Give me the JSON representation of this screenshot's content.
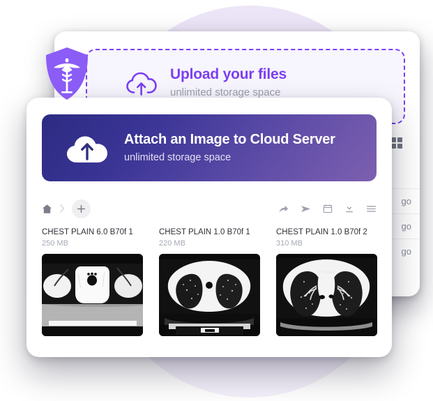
{
  "background_card": {
    "dropzone": {
      "title": "Upload your files",
      "subtitle": "unlimited storage space",
      "icon": "cloud-upload-outline-icon",
      "border_color": "#7b3ff2"
    },
    "grid_icon": "grid-view-icon",
    "rows": [
      {
        "time_text": "go"
      },
      {
        "time_text": "go"
      },
      {
        "time_text": "go"
      }
    ]
  },
  "badge": {
    "icon": "medical-shield-caduceus-icon",
    "color": "#8b5cf6"
  },
  "modal": {
    "banner": {
      "title": "Attach an Image to Cloud Server",
      "subtitle": "unlimited storage space",
      "icon": "cloud-upload-solid-icon",
      "gradient_from": "#2c2b82",
      "gradient_to": "#7d60b0"
    },
    "toolbar": {
      "home_icon": "home-icon",
      "separator_icon": "chevron-right-icon",
      "add_icon": "plus-icon",
      "actions": [
        {
          "name": "share-icon"
        },
        {
          "name": "send-icon"
        },
        {
          "name": "calendar-icon"
        },
        {
          "name": "download-icon"
        },
        {
          "name": "menu-icon"
        }
      ]
    },
    "files": [
      {
        "name": "CHEST PLAIN 6.0 B70f 1",
        "size": "250 MB",
        "thumb": "ct-spine-scan"
      },
      {
        "name": "CHEST PLAIN 1.0 B70f 1",
        "size": "220 MB",
        "thumb": "ct-lung-upper-scan"
      },
      {
        "name": "CHEST PLAIN 1.0 B70f 2",
        "size": "310 MB",
        "thumb": "ct-lung-mid-scan"
      }
    ]
  },
  "theme": {
    "backdrop_circle": "#ece5f7",
    "accent_purple": "#7b3ff2",
    "text_dark": "#2f3138",
    "text_muted": "#a6a9b4"
  }
}
